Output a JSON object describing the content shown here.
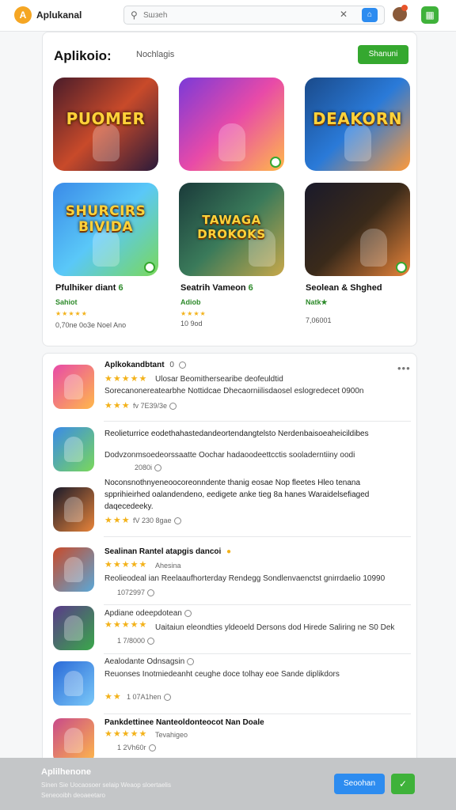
{
  "header": {
    "brand": "Aplukanal",
    "search_placeholder": "Sшзeh",
    "icons": [
      "search-icon",
      "clear-icon",
      "home-icon",
      "user-icon",
      "apps-icon"
    ]
  },
  "featured": {
    "title": "Aplikoio:",
    "subtitle": "Nochlagis",
    "button": "Shanuni",
    "tiles": [
      {
        "art": "PUOMER"
      },
      {
        "art": ""
      },
      {
        "art": "DEAKORN"
      },
      {
        "art": "SHURCIRS BIVIDA"
      },
      {
        "art": "TAWAGA DROKOKS"
      },
      {
        "art": ""
      }
    ],
    "apps": [
      {
        "name": "Pfulhiker diant",
        "badge": "6",
        "category": "Sahiot",
        "stars": "★★★★★",
        "meta": "0,70ne 0o3e Noel Ano"
      },
      {
        "name": "Seatrih Vameon",
        "badge": "6",
        "category": "Adiob",
        "stars": "★★★★",
        "meta": "10 9od"
      },
      {
        "name": "Seolean & Shghed",
        "badge": "",
        "category": "Natk★",
        "stars": "",
        "meta": "7,06001"
      }
    ]
  },
  "list": {
    "more_label": "•••",
    "items": [
      {
        "title": "Aplkokandbtant",
        "title_extra": "0",
        "stars": "★★★★★",
        "stars_note": "Ulosar Beomithersearibe deofeuldtid",
        "line": "Sorecanonereatearbhe Nottidcae Dhecaorniilisdaosel eslogredecet 0900n",
        "meta_stars": "★★★",
        "meta": "fv   7E39/3e"
      },
      {
        "title": "Reolieturrice eodethahastedandeortendangtelsto Nerdenbaisoeaheicildibes",
        "stars": "",
        "stars_note": "",
        "line": "Dodvzonmsoedeorssaatte   Oochar hadaoodeettcctis sooladerntiiny oodi",
        "meta_stars": "",
        "meta": "2080i"
      },
      {
        "title": "Noconsnothnyeneoocoreonndente thanig eosae Nop fleetes Hleo tenana",
        "line2": "spprihieirhed oalandendeno, eedigete anke tieg 8a hanes Waraidelsefiaged",
        "line3": "daqecedeeky.",
        "stars": "",
        "stars_note": "",
        "line": "",
        "meta_stars": "★★★",
        "meta": "fV   230 8gae"
      },
      {
        "title": "Sealinan Rantel atapgis dancoi",
        "stars": "★★★★★",
        "stars_note": "Ahesina",
        "line": "Reolieodeal ian Reelaaufhorterday Rendegg Sondlenvaenctst gnirrdaelio 10990",
        "meta_stars": "",
        "meta": "1072997"
      },
      {
        "title": "Apdiane odeepdotean",
        "stars": "★★★★★",
        "stars_note": "Uaitaiun eleondties yldeoeld Dersons dod Hirede Saliring ne S0 Dek",
        "line": "",
        "meta_stars": "",
        "meta": "1 7/8000"
      },
      {
        "title": "Aealodante Odnsagsin",
        "stars": "",
        "stars_note": "",
        "line": "Reuonses Inotmiedeanht ceughe doce tolhay eoe Sande diplikdors",
        "meta_stars": "★★",
        "meta": "1 07A1hen"
      },
      {
        "title": "Pankdettinee Nanteoldonteocot Nan Doale",
        "stars": "★★★★★",
        "stars_note": "Tevahigeo",
        "line": "",
        "meta_stars": "",
        "meta": "1 2Vh60r"
      }
    ]
  },
  "banner": {
    "title": "Aplilhenone",
    "line1": "Sinen Sie Uocaosoer selaip Weaop sloertaelis",
    "line2": "Seneooibh deoaeetaro",
    "button": "Seoohan",
    "check": "✓"
  }
}
